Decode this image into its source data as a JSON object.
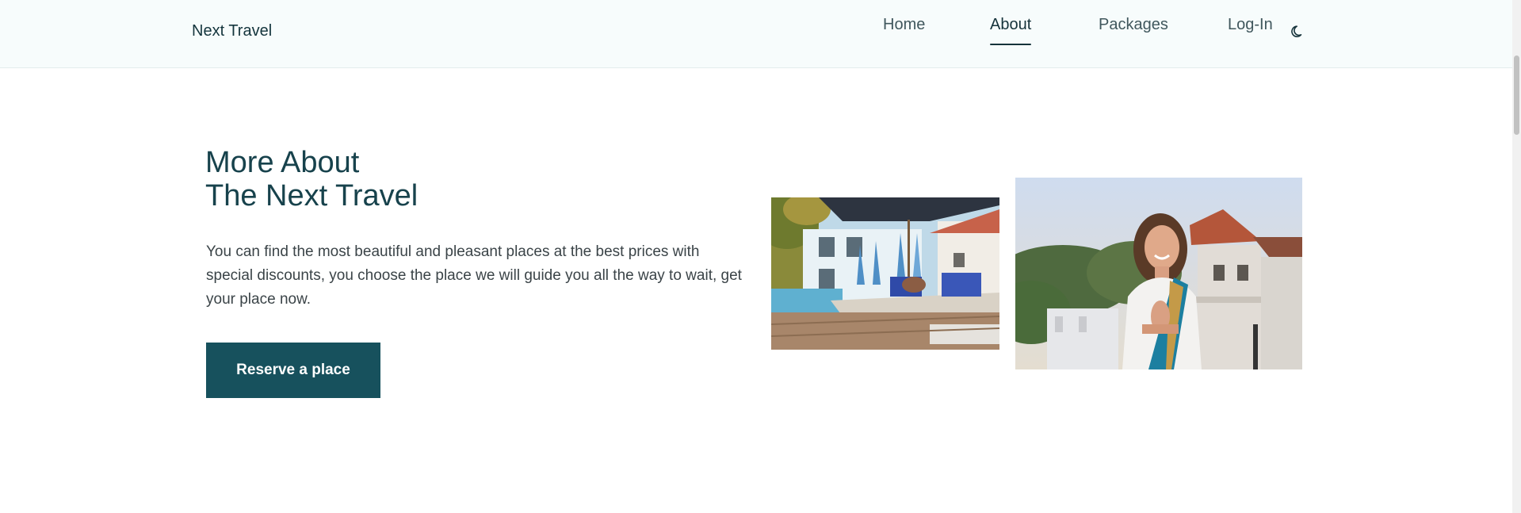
{
  "header": {
    "brand": "Next Travel",
    "nav": [
      {
        "label": "Home",
        "active": false
      },
      {
        "label": "About",
        "active": true
      },
      {
        "label": "Packages",
        "active": false
      },
      {
        "label": "Log-In",
        "active": false
      }
    ],
    "theme_toggle_icon": "moon-icon"
  },
  "about": {
    "title_line1": "More About",
    "title_line2": "The Next Travel",
    "description": "You can find the most beautiful and pleasant places at the best prices with special discounts, you choose the place we will guide you all the way to wait, get your place now.",
    "cta_label": "Reserve a place"
  },
  "colors": {
    "primary": "#17515d",
    "heading": "#17424c",
    "header_bg": "#f7fcfc"
  }
}
